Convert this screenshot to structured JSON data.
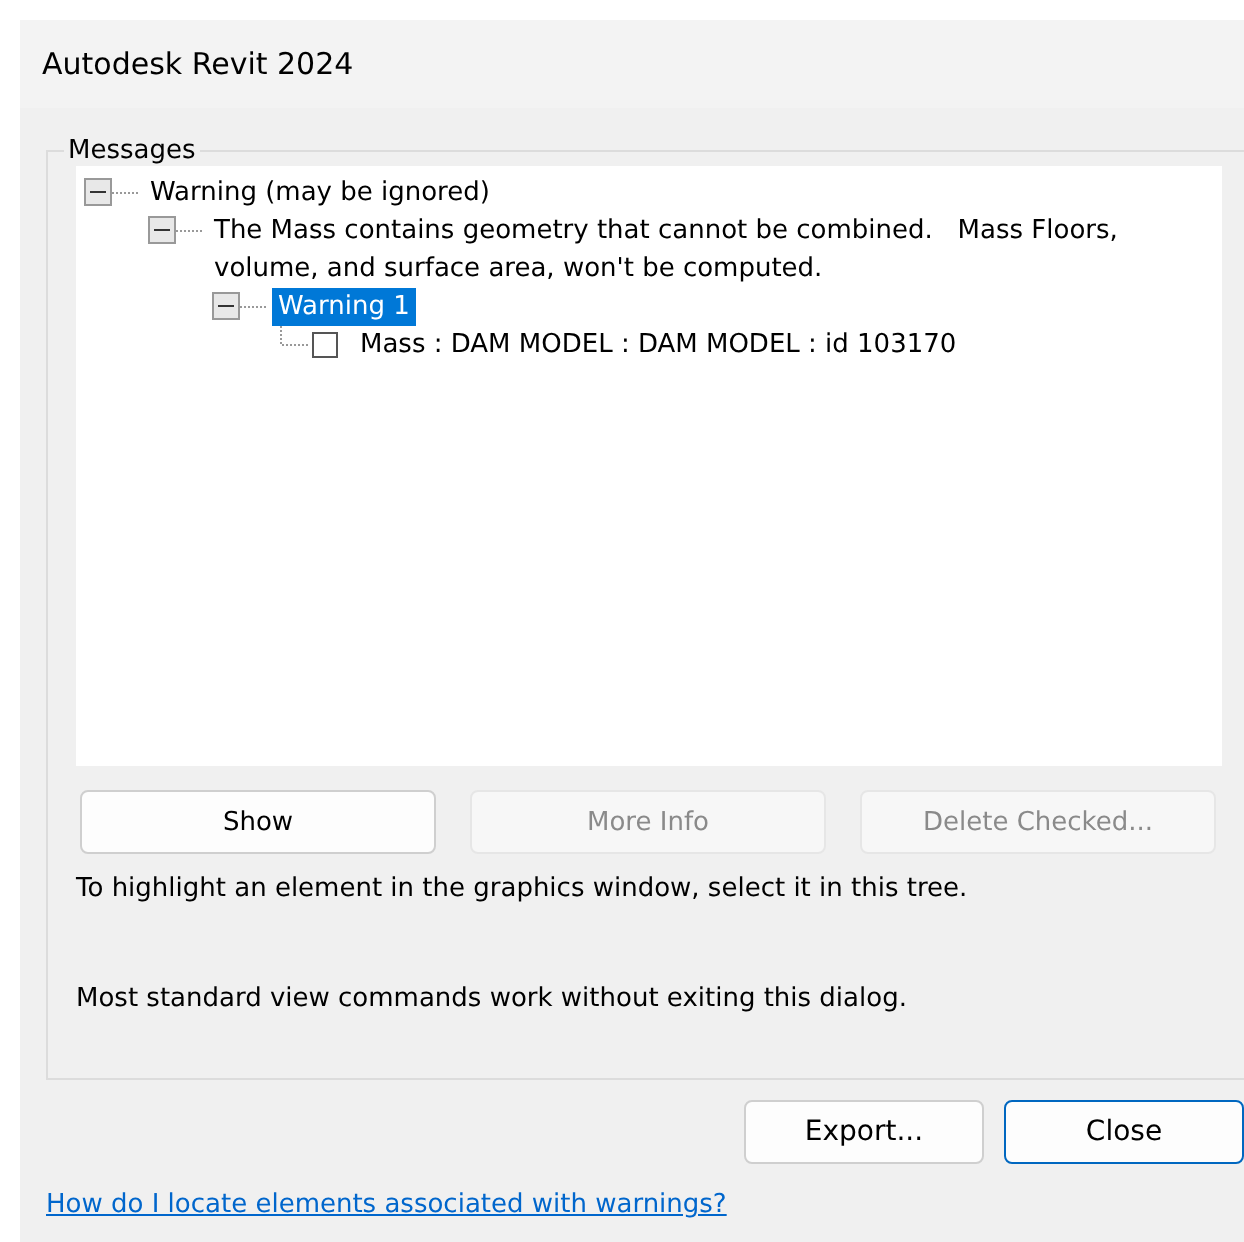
{
  "window": {
    "title": "Autodesk Revit 2024"
  },
  "messages": {
    "label": "Messages",
    "tree": [
      {
        "text": "Warning (may be ignored)",
        "expanded": true,
        "selected": false,
        "children": [
          {
            "text": "The Mass contains geometry that cannot be combined.   Mass Floors, volume, and surface area, won't be computed.",
            "expanded": true,
            "selected": false,
            "children": [
              {
                "text": "Warning 1",
                "expanded": true,
                "selected": true,
                "children": [
                  {
                    "text": "Mass : DAM MODEL : DAM MODEL : id 103170",
                    "checked": false,
                    "selected": false
                  }
                ]
              }
            ]
          }
        ]
      }
    ],
    "buttons": [
      {
        "label": "Show",
        "disabled": false
      },
      {
        "label": "More Info",
        "disabled": true
      },
      {
        "label": "Delete Checked...",
        "disabled": true
      }
    ],
    "hints": [
      "To highlight an element in the graphics window, select it in this tree.",
      "Most standard view commands work without exiting this dialog."
    ]
  },
  "footer_buttons": [
    {
      "label": "Export...",
      "default": false
    },
    {
      "label": "Close",
      "default": true
    }
  ],
  "help_link": "How do I locate elements associated with warnings? "
}
